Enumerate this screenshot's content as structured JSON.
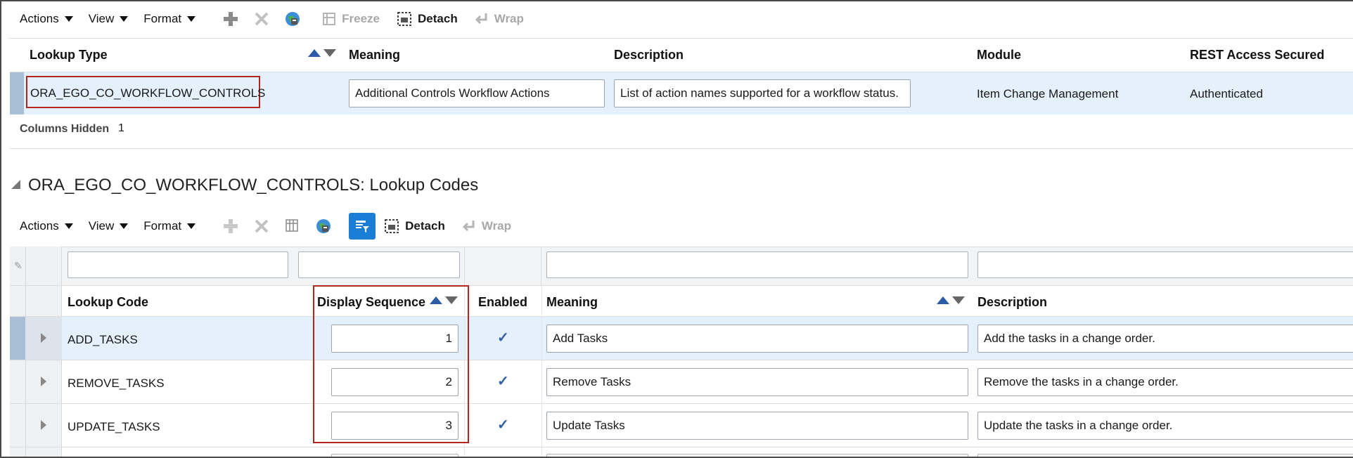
{
  "top_toolbar": {
    "actions": "Actions",
    "view": "View",
    "format": "Format",
    "freeze": "Freeze",
    "detach": "Detach",
    "wrap": "Wrap"
  },
  "types_table": {
    "headers": {
      "lookup_type": "Lookup Type",
      "meaning": "Meaning",
      "description": "Description",
      "module": "Module",
      "rest_access": "REST Access Secured"
    },
    "row": {
      "lookup_type": "ORA_EGO_CO_WORKFLOW_CONTROLS",
      "meaning": "Additional Controls Workflow Actions",
      "description": "List of action names supported for a workflow status.",
      "module": "Item Change Management",
      "rest_access": "Authenticated"
    },
    "columns_hidden_label": "Columns Hidden",
    "columns_hidden_count": "1"
  },
  "codes_section": {
    "title": "ORA_EGO_CO_WORKFLOW_CONTROLS: Lookup Codes",
    "toolbar": {
      "actions": "Actions",
      "view": "View",
      "format": "Format",
      "detach": "Detach",
      "wrap": "Wrap"
    },
    "headers": {
      "lookup_code": "Lookup Code",
      "display_sequence": "Display Sequence",
      "enabled": "Enabled",
      "meaning": "Meaning",
      "description": "Description"
    },
    "rows": [
      {
        "code": "ADD_TASKS",
        "sequence": "1",
        "enabled": "✓",
        "meaning": "Add Tasks",
        "description": "Add the tasks in a change order."
      },
      {
        "code": "REMOVE_TASKS",
        "sequence": "2",
        "enabled": "✓",
        "meaning": "Remove Tasks",
        "description": "Remove the tasks in a change order."
      },
      {
        "code": "UPDATE_TASKS",
        "sequence": "3",
        "enabled": "✓",
        "meaning": "Update Tasks",
        "description": "Update the tasks in a change order."
      }
    ]
  },
  "colors": {
    "selected_row": "#e4f0fb",
    "selected_marker": "#a9bfd6",
    "highlight_border": "#b3271f",
    "accent": "#2b5ca8"
  }
}
